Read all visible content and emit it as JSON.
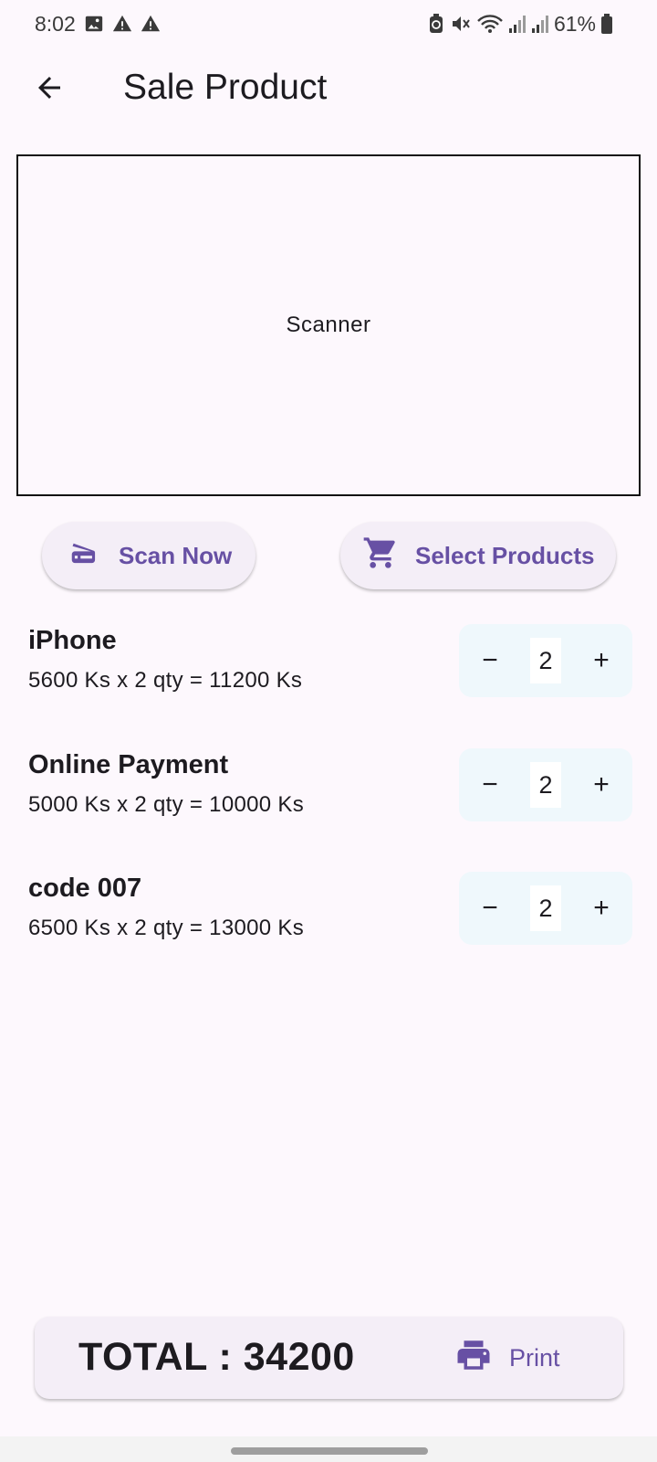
{
  "status_bar": {
    "time": "8:02",
    "battery": "61%",
    "left_icons": [
      "image-icon",
      "warning-icon",
      "warning-icon"
    ],
    "right_icons": [
      "battery-saver-icon",
      "mute-icon",
      "wifi-icon",
      "signal-icon",
      "signal-icon",
      "battery-icon"
    ]
  },
  "app_bar": {
    "title": "Sale Product",
    "back_icon": "arrow-back-icon"
  },
  "scanner": {
    "label": "Scanner"
  },
  "actions": {
    "scan_label": "Scan Now",
    "scan_icon": "scanner-icon",
    "select_label": "Select Products",
    "select_icon": "cart-icon"
  },
  "products": [
    {
      "name": "iPhone",
      "detail": "5600 Ks x 2 qty = 11200 Ks",
      "qty": "2"
    },
    {
      "name": "Online Payment",
      "detail": "5000 Ks x 2 qty = 10000 Ks",
      "qty": "2"
    },
    {
      "name": "code 007",
      "detail": "6500 Ks x 2 qty = 13000 Ks",
      "qty": "2"
    }
  ],
  "stepper": {
    "minus": "−",
    "plus": "+"
  },
  "footer": {
    "total": "TOTAL : 34200",
    "print_label": "Print",
    "print_icon": "print-icon"
  },
  "colors": {
    "accent": "#6750a4",
    "background": "#fdf8fd",
    "button_surface": "#f4eef7",
    "stepper_surface": "#eff8fc"
  }
}
